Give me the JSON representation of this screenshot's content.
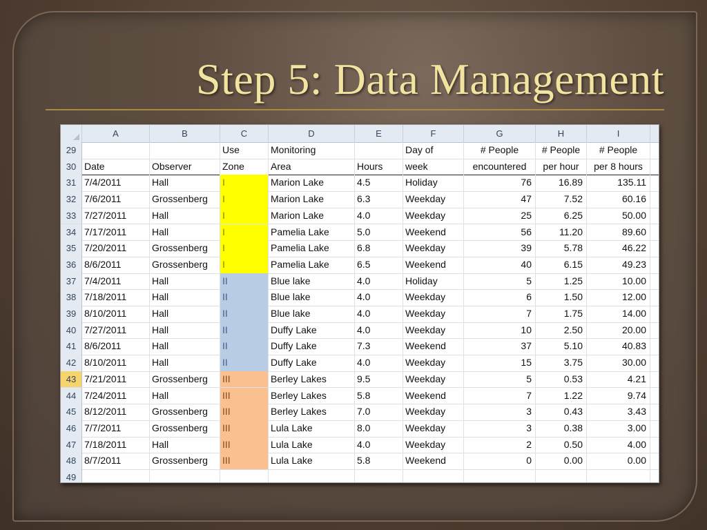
{
  "slide": {
    "title": "Step 5: Data Management"
  },
  "columns": [
    "A",
    "B",
    "C",
    "D",
    "E",
    "F",
    "G",
    "H",
    "I"
  ],
  "header_rows": [
    {
      "row": "29",
      "cells": [
        "",
        "",
        "Use",
        "Monitoring",
        "",
        "Day of",
        "# People",
        "# People",
        "# People"
      ]
    },
    {
      "row": "30",
      "cells": [
        "Date",
        "Observer",
        "Zone",
        "Area",
        "Hours",
        "week",
        "encountered",
        "per hour",
        "per 8 hours"
      ]
    }
  ],
  "rows": [
    {
      "row": "31",
      "date": "7/4/2011",
      "observer": "Hall",
      "zone": "I",
      "area": "Marion Lake",
      "hours": "4.5",
      "day": "Holiday",
      "people": "76",
      "per_hour": "16.89",
      "per_8": "135.11"
    },
    {
      "row": "32",
      "date": "7/6/2011",
      "observer": "Grossenberg",
      "zone": "I",
      "area": "Marion Lake",
      "hours": "6.3",
      "day": "Weekday",
      "people": "47",
      "per_hour": "7.52",
      "per_8": "60.16"
    },
    {
      "row": "33",
      "date": "7/27/2011",
      "observer": "Hall",
      "zone": "I",
      "area": "Marion Lake",
      "hours": "4.0",
      "day": "Weekday",
      "people": "25",
      "per_hour": "6.25",
      "per_8": "50.00"
    },
    {
      "row": "34",
      "date": "7/17/2011",
      "observer": "Hall",
      "zone": "I",
      "area": "Pamelia Lake",
      "hours": "5.0",
      "day": "Weekend",
      "people": "56",
      "per_hour": "11.20",
      "per_8": "89.60"
    },
    {
      "row": "35",
      "date": "7/20/2011",
      "observer": "Grossenberg",
      "zone": "I",
      "area": "Pamelia Lake",
      "hours": "6.8",
      "day": "Weekday",
      "people": "39",
      "per_hour": "5.78",
      "per_8": "46.22"
    },
    {
      "row": "36",
      "date": "8/6/2011",
      "observer": "Grossenberg",
      "zone": "I",
      "area": "Pamelia Lake",
      "hours": "6.5",
      "day": "Weekend",
      "people": "40",
      "per_hour": "6.15",
      "per_8": "49.23"
    },
    {
      "row": "37",
      "date": "7/4/2011",
      "observer": "Hall",
      "zone": "II",
      "area": "Blue lake",
      "hours": "4.0",
      "day": "Holiday",
      "people": "5",
      "per_hour": "1.25",
      "per_8": "10.00"
    },
    {
      "row": "38",
      "date": "7/18/2011",
      "observer": "Hall",
      "zone": "II",
      "area": "Blue lake",
      "hours": "4.0",
      "day": "Weekday",
      "people": "6",
      "per_hour": "1.50",
      "per_8": "12.00"
    },
    {
      "row": "39",
      "date": "8/10/2011",
      "observer": "Hall",
      "zone": "II",
      "area": "Blue lake",
      "hours": "4.0",
      "day": "Weekday",
      "people": "7",
      "per_hour": "1.75",
      "per_8": "14.00"
    },
    {
      "row": "40",
      "date": "7/27/2011",
      "observer": "Hall",
      "zone": "II",
      "area": "Duffy Lake",
      "hours": "4.0",
      "day": "Weekday",
      "people": "10",
      "per_hour": "2.50",
      "per_8": "20.00"
    },
    {
      "row": "41",
      "date": "8/6/2011",
      "observer": "Hall",
      "zone": "II",
      "area": "Duffy Lake",
      "hours": "7.3",
      "day": "Weekend",
      "people": "37",
      "per_hour": "5.10",
      "per_8": "40.83"
    },
    {
      "row": "42",
      "date": "8/10/2011",
      "observer": "Hall",
      "zone": "II",
      "area": "Duffy Lake",
      "hours": "4.0",
      "day": "Weekday",
      "people": "15",
      "per_hour": "3.75",
      "per_8": "30.00"
    },
    {
      "row": "43",
      "date": "7/21/2011",
      "observer": "Grossenberg",
      "zone": "III",
      "area": "Berley Lakes",
      "hours": "9.5",
      "day": "Weekday",
      "people": "5",
      "per_hour": "0.53",
      "per_8": "4.21"
    },
    {
      "row": "44",
      "date": "7/24/2011",
      "observer": "Hall",
      "zone": "III",
      "area": "Berley Lakes",
      "hours": "5.8",
      "day": "Weekend",
      "people": "7",
      "per_hour": "1.22",
      "per_8": "9.74"
    },
    {
      "row": "45",
      "date": "8/12/2011",
      "observer": "Grossenberg",
      "zone": "III",
      "area": "Berley Lakes",
      "hours": "7.0",
      "day": "Weekday",
      "people": "3",
      "per_hour": "0.43",
      "per_8": "3.43"
    },
    {
      "row": "46",
      "date": "7/7/2011",
      "observer": "Grossenberg",
      "zone": "III",
      "area": "Lula Lake",
      "hours": "8.0",
      "day": "Weekday",
      "people": "3",
      "per_hour": "0.38",
      "per_8": "3.00"
    },
    {
      "row": "47",
      "date": "7/18/2011",
      "observer": "Hall",
      "zone": "III",
      "area": "Lula Lake",
      "hours": "4.0",
      "day": "Weekday",
      "people": "2",
      "per_hour": "0.50",
      "per_8": "4.00"
    },
    {
      "row": "48",
      "date": "8/7/2011",
      "observer": "Grossenberg",
      "zone": "III",
      "area": "Lula Lake",
      "hours": "5.8",
      "day": "Weekend",
      "people": "0",
      "per_hour": "0.00",
      "per_8": "0.00"
    }
  ],
  "trailing_row": "49",
  "selected_row": "43",
  "zone_colors": {
    "I": "#ffff00",
    "II": "#b8cce4",
    "III": "#fac090"
  }
}
